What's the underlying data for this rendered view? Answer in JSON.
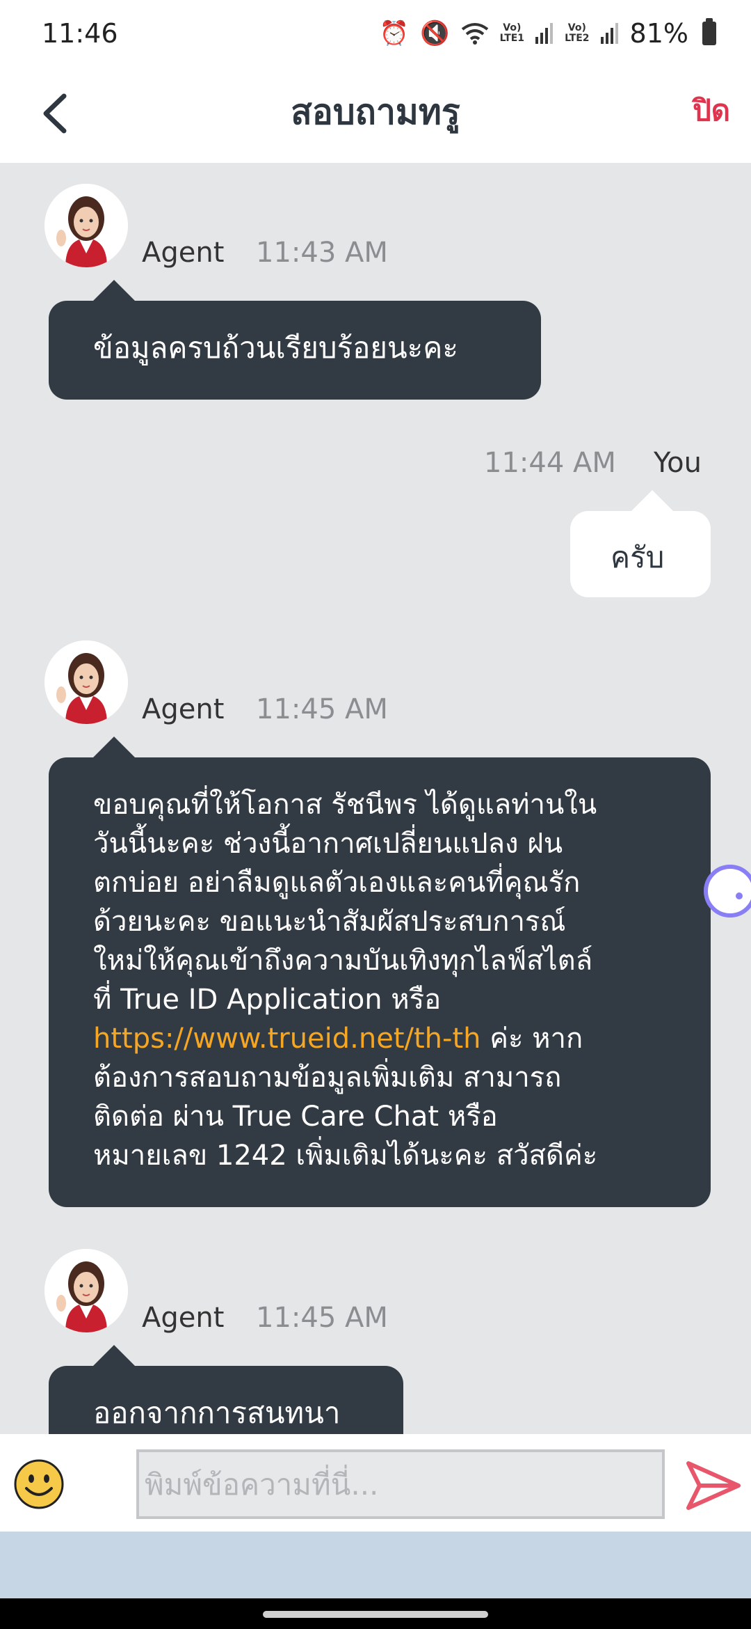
{
  "status_bar": {
    "time": "11:46",
    "lte1_top": "Vo)",
    "lte1_bottom": "LTE1",
    "lte2_top": "Vo)",
    "lte2_bottom": "LTE2",
    "battery": "81%"
  },
  "header": {
    "title": "สอบถามทรู",
    "close_label": "ปิด"
  },
  "messages": [
    {
      "sender": "Agent",
      "time": "11:43  AM",
      "text": "ข้อมูลครบถ้วนเรียบร้อยนะคะ"
    },
    {
      "sender": "You",
      "time": "11:44  AM",
      "text": "ครับ"
    },
    {
      "sender": "Agent",
      "time": "11:45  AM",
      "lines": [
        "ขอบคุณที่ให้โอกาส รัชนีพร ได้ดูแลท่านใน",
        "วันนี้นะคะ ช่วงนี้อากาศเปลี่ยนแปลง ฝน",
        "ตกบ่อย อย่าลืมดูแลตัวเองและคนที่คุณรัก",
        "ด้วยนะคะ ขอแนะนำสัมผัสประสบการณ์",
        "ใหม่ให้คุณเข้าถึงความบันเทิงทุกไลฟ์สไตล์",
        "ที่ True ID Application หรือ"
      ],
      "link": "https://www.trueid.net/th-th",
      "after_link": " ค่ะ หาก",
      "lines_after": [
        "ต้องการสอบถามข้อมูลเพิ่มเติม สามารถ",
        "ติดต่อ ผ่าน True Care Chat หรือ",
        "หมายเลข 1242 เพิ่มเติมได้นะคะ สวัสดีค่ะ"
      ]
    },
    {
      "sender": "Agent",
      "time": "11:45  AM",
      "text": "ออกจากการสนทนา"
    }
  ],
  "input": {
    "placeholder": "พิมพ์ข้อความที่นี่..."
  },
  "colors": {
    "accent_red": "#e0334e",
    "bubble_dark": "#323a44",
    "link": "#f5a623"
  },
  "icons": {
    "back": "chevron-left-icon",
    "emoji": "smiley-icon",
    "send": "send-icon"
  }
}
